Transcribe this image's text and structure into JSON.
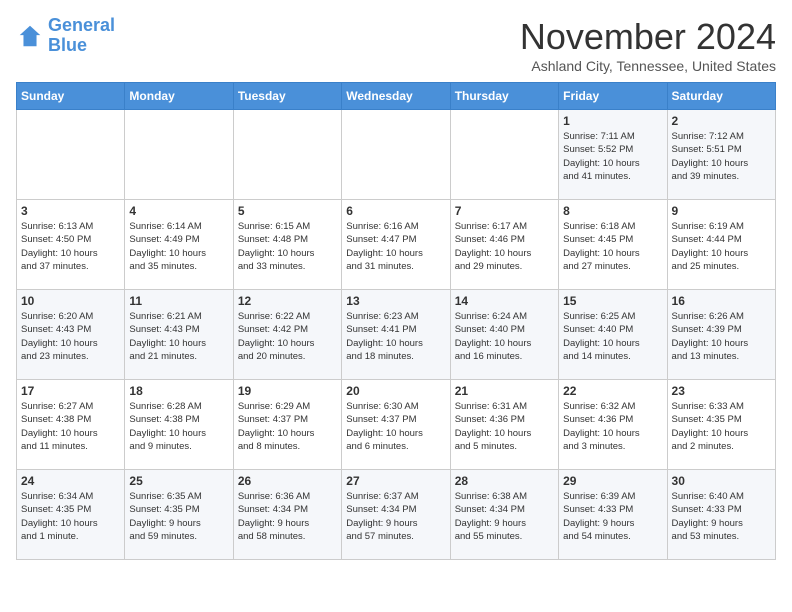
{
  "logo": {
    "line1": "General",
    "line2": "Blue"
  },
  "title": "November 2024",
  "subtitle": "Ashland City, Tennessee, United States",
  "days_of_week": [
    "Sunday",
    "Monday",
    "Tuesday",
    "Wednesday",
    "Thursday",
    "Friday",
    "Saturday"
  ],
  "weeks": [
    [
      {
        "day": "",
        "info": ""
      },
      {
        "day": "",
        "info": ""
      },
      {
        "day": "",
        "info": ""
      },
      {
        "day": "",
        "info": ""
      },
      {
        "day": "",
        "info": ""
      },
      {
        "day": "1",
        "info": "Sunrise: 7:11 AM\nSunset: 5:52 PM\nDaylight: 10 hours\nand 41 minutes."
      },
      {
        "day": "2",
        "info": "Sunrise: 7:12 AM\nSunset: 5:51 PM\nDaylight: 10 hours\nand 39 minutes."
      }
    ],
    [
      {
        "day": "3",
        "info": "Sunrise: 6:13 AM\nSunset: 4:50 PM\nDaylight: 10 hours\nand 37 minutes."
      },
      {
        "day": "4",
        "info": "Sunrise: 6:14 AM\nSunset: 4:49 PM\nDaylight: 10 hours\nand 35 minutes."
      },
      {
        "day": "5",
        "info": "Sunrise: 6:15 AM\nSunset: 4:48 PM\nDaylight: 10 hours\nand 33 minutes."
      },
      {
        "day": "6",
        "info": "Sunrise: 6:16 AM\nSunset: 4:47 PM\nDaylight: 10 hours\nand 31 minutes."
      },
      {
        "day": "7",
        "info": "Sunrise: 6:17 AM\nSunset: 4:46 PM\nDaylight: 10 hours\nand 29 minutes."
      },
      {
        "day": "8",
        "info": "Sunrise: 6:18 AM\nSunset: 4:45 PM\nDaylight: 10 hours\nand 27 minutes."
      },
      {
        "day": "9",
        "info": "Sunrise: 6:19 AM\nSunset: 4:44 PM\nDaylight: 10 hours\nand 25 minutes."
      }
    ],
    [
      {
        "day": "10",
        "info": "Sunrise: 6:20 AM\nSunset: 4:43 PM\nDaylight: 10 hours\nand 23 minutes."
      },
      {
        "day": "11",
        "info": "Sunrise: 6:21 AM\nSunset: 4:43 PM\nDaylight: 10 hours\nand 21 minutes."
      },
      {
        "day": "12",
        "info": "Sunrise: 6:22 AM\nSunset: 4:42 PM\nDaylight: 10 hours\nand 20 minutes."
      },
      {
        "day": "13",
        "info": "Sunrise: 6:23 AM\nSunset: 4:41 PM\nDaylight: 10 hours\nand 18 minutes."
      },
      {
        "day": "14",
        "info": "Sunrise: 6:24 AM\nSunset: 4:40 PM\nDaylight: 10 hours\nand 16 minutes."
      },
      {
        "day": "15",
        "info": "Sunrise: 6:25 AM\nSunset: 4:40 PM\nDaylight: 10 hours\nand 14 minutes."
      },
      {
        "day": "16",
        "info": "Sunrise: 6:26 AM\nSunset: 4:39 PM\nDaylight: 10 hours\nand 13 minutes."
      }
    ],
    [
      {
        "day": "17",
        "info": "Sunrise: 6:27 AM\nSunset: 4:38 PM\nDaylight: 10 hours\nand 11 minutes."
      },
      {
        "day": "18",
        "info": "Sunrise: 6:28 AM\nSunset: 4:38 PM\nDaylight: 10 hours\nand 9 minutes."
      },
      {
        "day": "19",
        "info": "Sunrise: 6:29 AM\nSunset: 4:37 PM\nDaylight: 10 hours\nand 8 minutes."
      },
      {
        "day": "20",
        "info": "Sunrise: 6:30 AM\nSunset: 4:37 PM\nDaylight: 10 hours\nand 6 minutes."
      },
      {
        "day": "21",
        "info": "Sunrise: 6:31 AM\nSunset: 4:36 PM\nDaylight: 10 hours\nand 5 minutes."
      },
      {
        "day": "22",
        "info": "Sunrise: 6:32 AM\nSunset: 4:36 PM\nDaylight: 10 hours\nand 3 minutes."
      },
      {
        "day": "23",
        "info": "Sunrise: 6:33 AM\nSunset: 4:35 PM\nDaylight: 10 hours\nand 2 minutes."
      }
    ],
    [
      {
        "day": "24",
        "info": "Sunrise: 6:34 AM\nSunset: 4:35 PM\nDaylight: 10 hours\nand 1 minute."
      },
      {
        "day": "25",
        "info": "Sunrise: 6:35 AM\nSunset: 4:35 PM\nDaylight: 9 hours\nand 59 minutes."
      },
      {
        "day": "26",
        "info": "Sunrise: 6:36 AM\nSunset: 4:34 PM\nDaylight: 9 hours\nand 58 minutes."
      },
      {
        "day": "27",
        "info": "Sunrise: 6:37 AM\nSunset: 4:34 PM\nDaylight: 9 hours\nand 57 minutes."
      },
      {
        "day": "28",
        "info": "Sunrise: 6:38 AM\nSunset: 4:34 PM\nDaylight: 9 hours\nand 55 minutes."
      },
      {
        "day": "29",
        "info": "Sunrise: 6:39 AM\nSunset: 4:33 PM\nDaylight: 9 hours\nand 54 minutes."
      },
      {
        "day": "30",
        "info": "Sunrise: 6:40 AM\nSunset: 4:33 PM\nDaylight: 9 hours\nand 53 minutes."
      }
    ]
  ]
}
